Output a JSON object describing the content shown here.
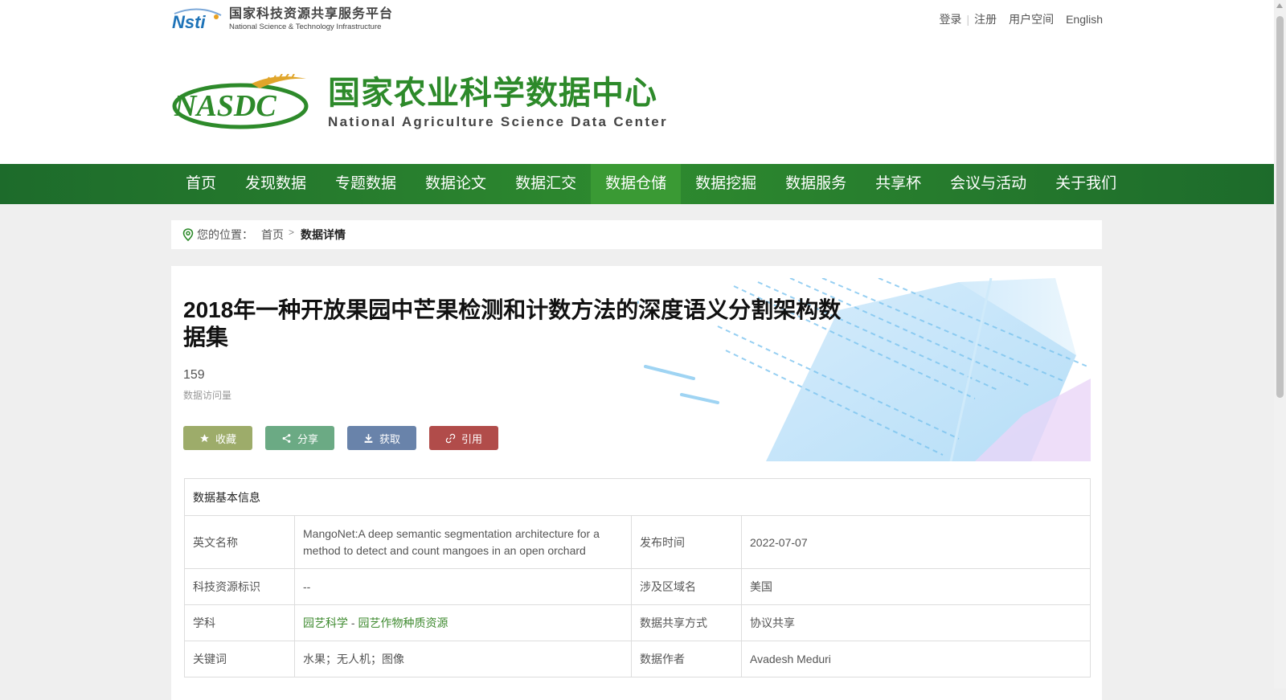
{
  "topbar": {
    "platform_cn": "国家科技资源共享服务平台",
    "platform_en": "National Science & Technology Infrastructure",
    "login": "登录",
    "register": "注册",
    "user_space": "用户空间",
    "english": "English"
  },
  "site": {
    "name_cn": "国家农业科学数据中心",
    "name_en": "National Agriculture Science Data Center",
    "logo_mark": "NASDC"
  },
  "nav": {
    "items": [
      {
        "label": "首页"
      },
      {
        "label": "发现数据"
      },
      {
        "label": "专题数据"
      },
      {
        "label": "数据论文"
      },
      {
        "label": "数据汇交"
      },
      {
        "label": "数据仓储"
      },
      {
        "label": "数据挖掘"
      },
      {
        "label": "数据服务"
      },
      {
        "label": "共享杯"
      },
      {
        "label": "会议与活动"
      },
      {
        "label": "关于我们"
      }
    ]
  },
  "breadcrumb": {
    "label": "您的位置：",
    "home": "首页",
    "current": "数据详情"
  },
  "dataset": {
    "title": "2018年一种开放果园中芒果检测和计数方法的深度语义分割架构数据集",
    "views": "159",
    "views_label": "数据访问量"
  },
  "actions": {
    "favorite": "收藏",
    "share": "分享",
    "get": "获取",
    "cite": "引用"
  },
  "info": {
    "header": "数据基本信息",
    "en_name_label": "英文名称",
    "en_name": "MangoNet:A deep semantic segmentation architecture for a method to detect and count mangoes in an open orchard",
    "publish_label": "发布时间",
    "publish": "2022-07-07",
    "id_label": "科技资源标识",
    "id": "--",
    "region_label": "涉及区域名",
    "region": "美国",
    "subject_label": "学科",
    "subject_1": "园艺科学",
    "subject_sep": " - ",
    "subject_2": "园艺作物种质资源",
    "share_mode_label": "数据共享方式",
    "share_mode": "协议共享",
    "keywords_label": "关键词",
    "keywords": "水果；无人机；图像",
    "author_label": "数据作者",
    "author": "Avadesh Meduri"
  },
  "colors": {
    "nav_green": "#2e8a2f",
    "brand_green": "#2d8a2a",
    "btn_favorite": "#9dac6a",
    "btn_share": "#6baa84",
    "btn_get": "#6983aa",
    "btn_cite": "#b14c4a"
  }
}
